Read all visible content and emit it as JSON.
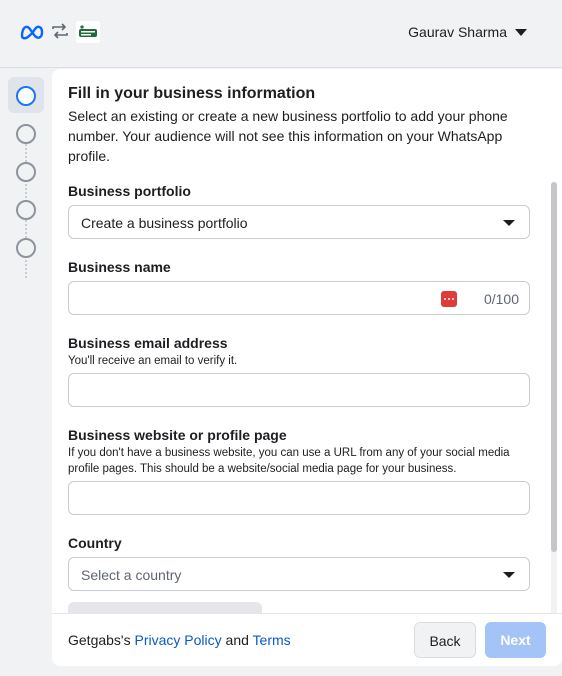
{
  "header": {
    "user_name": "Gaurav Sharma"
  },
  "steps": [
    {
      "state": "active"
    },
    {
      "state": "pending"
    },
    {
      "state": "pending"
    },
    {
      "state": "pending"
    },
    {
      "state": "pending"
    }
  ],
  "form": {
    "title": "Fill in your business information",
    "description": "Select an existing or create a new business portfolio to add your phone number. Your audience will not see this information on your WhatsApp profile.",
    "portfolio": {
      "label": "Business portfolio",
      "value": "Create a business portfolio"
    },
    "business_name": {
      "label": "Business name",
      "value": "",
      "counter": "0/100"
    },
    "email": {
      "label": "Business email address",
      "hint": "You'll receive an email to verify it.",
      "value": ""
    },
    "website": {
      "label": "Business website or profile page",
      "hint": "If you don't have a business website, you can use a URL from any of your social media profile pages. This should be a website/social media page for your business.",
      "value": ""
    },
    "country": {
      "label": "Country",
      "placeholder": "Select a country"
    }
  },
  "footer": {
    "prefix": "Getgabs's",
    "privacy_label": "Privacy Policy",
    "and_text": "and",
    "terms_label": "Terms",
    "back_label": "Back",
    "next_label": "Next"
  },
  "colors": {
    "accent": "#1877f2",
    "next_disabled": "#a4c3f7",
    "link": "#0a58ca"
  }
}
